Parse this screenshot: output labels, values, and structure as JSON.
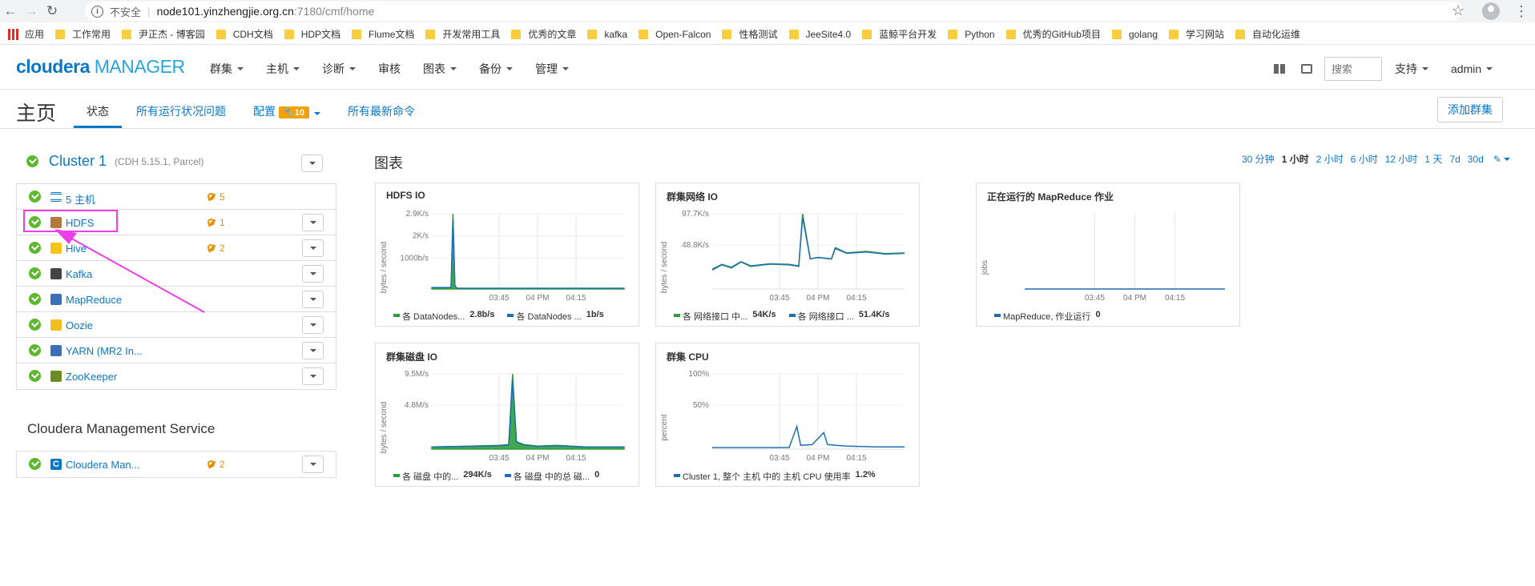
{
  "browser": {
    "insecure_label": "不安全",
    "url_host": "node101.yinzhengjie.org.cn",
    "url_rest": ":7180/cmf/home",
    "bookmarks": [
      "应用",
      "工作常用",
      "尹正杰 - 博客园",
      "CDH文档",
      "HDP文档",
      "Flume文档",
      "开发常用工具",
      "优秀的文章",
      "kafka",
      "Open-Falcon",
      "性格测试",
      "JeeSite4.0",
      "蓝鲸平台开发",
      "Python",
      "优秀的GitHub项目",
      "golang",
      "学习网站",
      "自动化运维"
    ]
  },
  "header": {
    "logo_brand": "cloudera",
    "logo_product": "MANAGER",
    "nav": [
      "群集",
      "主机",
      "诊断",
      "审核",
      "图表",
      "备份",
      "管理"
    ],
    "nav_has_caret": [
      true,
      true,
      true,
      false,
      true,
      true,
      true
    ],
    "search_placeholder": "搜索",
    "support_label": "支持",
    "user_label": "admin"
  },
  "page": {
    "title": "主页",
    "tabs": [
      "状态",
      "所有运行状况问题",
      "配置",
      "所有最新命令"
    ],
    "config_badge": "10",
    "add_cluster_label": "添加群集"
  },
  "cluster": {
    "name": "Cluster 1",
    "subtitle": "(CDH 5.15.1, Parcel)",
    "services": [
      {
        "name": "5 主机",
        "warnings": "5",
        "icon": "hosts-list-icon",
        "color": "#0a78c7"
      },
      {
        "name": "HDFS",
        "warnings": "1",
        "icon": "hdfs-icon",
        "color": "#b07a3a"
      },
      {
        "name": "Hive",
        "warnings": "2",
        "icon": "hive-icon",
        "color": "#f5c518"
      },
      {
        "name": "Kafka",
        "warnings": "",
        "icon": "kafka-icon",
        "color": "#444444"
      },
      {
        "name": "MapReduce",
        "warnings": "",
        "icon": "mapreduce-icon",
        "color": "#3b6fb6"
      },
      {
        "name": "Oozie",
        "warnings": "",
        "icon": "oozie-icon",
        "color": "#f0c020"
      },
      {
        "name": "YARN (MR2 In...",
        "warnings": "",
        "icon": "yarn-icon",
        "color": "#3b6fb6"
      },
      {
        "name": "ZooKeeper",
        "warnings": "",
        "icon": "zookeeper-icon",
        "color": "#6b8e23"
      }
    ]
  },
  "mgmt": {
    "title": "Cloudera Management Service",
    "service_name": "Cloudera Man...",
    "warnings": "2"
  },
  "charts": {
    "title": "图表",
    "time_ranges": [
      "30 分钟",
      "1 小时",
      "2 小时",
      "6 小时",
      "12 小时",
      "1 天",
      "7d",
      "30d"
    ],
    "selected_range": "1 小时"
  },
  "chart_data": [
    {
      "type": "area",
      "title": "HDFS IO",
      "ylabel": "bytes / second",
      "yticks": [
        "2.9K/s",
        "2K/s",
        "1000b/s"
      ],
      "xticks": [
        "03:45",
        "04 PM",
        "04:15"
      ],
      "series": [
        {
          "name": "各 DataNodes...",
          "value": "2.8b/s",
          "color": "#2e9e3a"
        },
        {
          "name": "各 DataNodes ...",
          "value": "1b/s",
          "color": "#1f6fb5"
        }
      ]
    },
    {
      "type": "line",
      "title": "群集网络 IO",
      "ylabel": "bytes / second",
      "yticks": [
        "97.7K/s",
        "48.8K/s"
      ],
      "xticks": [
        "03:45",
        "04 PM",
        "04:15"
      ],
      "series": [
        {
          "name": "各 网络接口 中...",
          "value": "54K/s",
          "color": "#2e9e3a"
        },
        {
          "name": "各 网络接口 ...",
          "value": "51.4K/s",
          "color": "#1f6fb5"
        }
      ]
    },
    {
      "type": "line",
      "title": "正在运行的 MapReduce 作业",
      "ylabel": "jobs",
      "yticks": [],
      "xticks": [
        "03:45",
        "04 PM",
        "04:15"
      ],
      "series": [
        {
          "name": "MapReduce, 作业运行",
          "value": "0",
          "color": "#1f6fb5"
        }
      ]
    },
    {
      "type": "area",
      "title": "群集磁盘 IO",
      "ylabel": "bytes / second",
      "yticks": [
        "9.5M/s",
        "4.8M/s"
      ],
      "xticks": [
        "03:45",
        "04 PM",
        "04:15"
      ],
      "series": [
        {
          "name": "各 磁盘 中的...",
          "value": "294K/s",
          "color": "#2e9e3a"
        },
        {
          "name": "各 磁盘 中的总 磁...",
          "value": "0",
          "color": "#1f6fb5"
        }
      ]
    },
    {
      "type": "line",
      "title": "群集 CPU",
      "ylabel": "percent",
      "yticks": [
        "100%",
        "50%"
      ],
      "xticks": [
        "03:45",
        "04 PM",
        "04:15"
      ],
      "series": [
        {
          "name": "Cluster 1, 整个 主机 中的 主机 CPU 使用率",
          "value": "1.2%",
          "color": "#1f6fb5"
        }
      ]
    }
  ]
}
